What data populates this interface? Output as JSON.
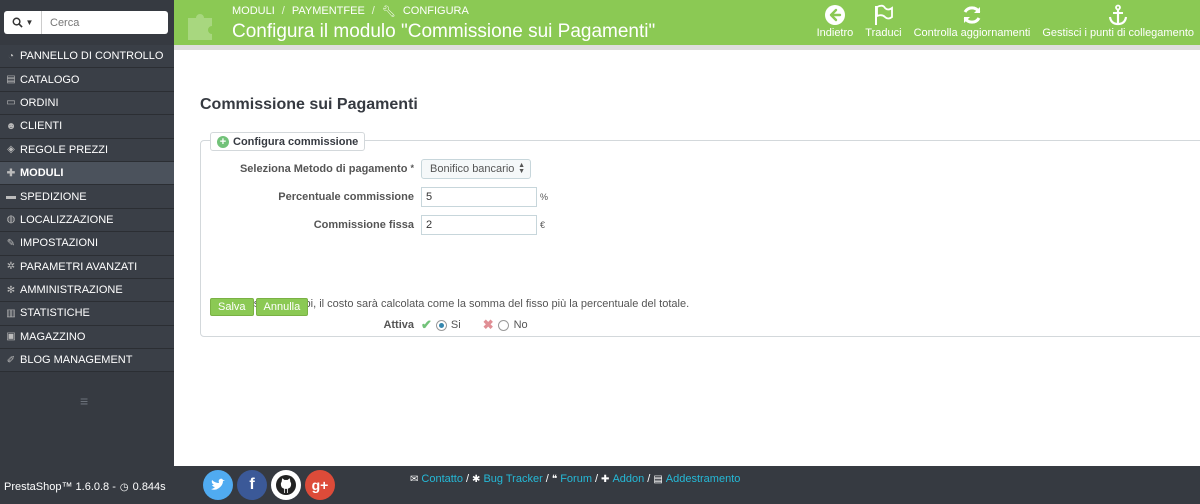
{
  "sidebar": {
    "search": {
      "placeholder": "Cerca"
    },
    "items": [
      {
        "label": "PANNELLO DI CONTROLLO",
        "icon": "dashboard-icon",
        "glyph": "◔"
      },
      {
        "label": "CATALOGO",
        "icon": "book-icon",
        "glyph": "▤"
      },
      {
        "label": "ORDINI",
        "icon": "credit-card-icon",
        "glyph": "▭"
      },
      {
        "label": "CLIENTI",
        "icon": "users-icon",
        "glyph": "☻"
      },
      {
        "label": "REGOLE PREZZI",
        "icon": "tag-icon",
        "glyph": "◈"
      },
      {
        "label": "MODULI",
        "icon": "puzzle-icon",
        "glyph": "✚"
      },
      {
        "label": "SPEDIZIONE",
        "icon": "truck-icon",
        "glyph": "▬"
      },
      {
        "label": "LOCALIZZAZIONE",
        "icon": "globe-icon",
        "glyph": "◍"
      },
      {
        "label": "IMPOSTAZIONI",
        "icon": "wrench-icon",
        "glyph": "✎"
      },
      {
        "label": "PARAMETRI AVANZATI",
        "icon": "cogs-icon",
        "glyph": "✲"
      },
      {
        "label": "AMMINISTRAZIONE",
        "icon": "cog-icon",
        "glyph": "✻"
      },
      {
        "label": "STATISTICHE",
        "icon": "bar-chart-icon",
        "glyph": "▥"
      },
      {
        "label": "MAGAZZINO",
        "icon": "archive-icon",
        "glyph": "▣"
      },
      {
        "label": "BLOG MANAGEMENT",
        "icon": "pencil-icon",
        "glyph": "✐"
      }
    ],
    "active_index": 5
  },
  "header": {
    "breadcrumb": [
      "MODULI",
      "PAYMENTFEE",
      "CONFIGURA"
    ],
    "title": "Configura il modulo \"Commissione sui Pagamenti\"",
    "toolbar": [
      {
        "label": "Indietro",
        "icon": "arrow-circle-left-icon"
      },
      {
        "label": "Traduci",
        "icon": "flag-icon"
      },
      {
        "label": "Controlla aggiornamenti",
        "icon": "refresh-icon"
      },
      {
        "label": "Gestisci i punti di collegamento",
        "icon": "anchor-icon"
      }
    ]
  },
  "content": {
    "section_title": "Commissione sui Pagamenti",
    "panel_title": "Configura commissione",
    "payment_method": {
      "label": "Seleziona Metodo di pagamento",
      "required_mark": "*",
      "value": "Bonifico bancario"
    },
    "percent_fee": {
      "label": "Percentuale commissione",
      "value": "5",
      "unit": "%"
    },
    "fixed_fee": {
      "label": "Commissione fissa",
      "value": "2",
      "unit": "€"
    },
    "help_text": "Se inserisci entrambi, il costo sarà calcolata come la somma del fisso più la percentuale del totale.",
    "active": {
      "label": "Attiva",
      "yes": "Si",
      "no": "No",
      "selected": "yes"
    },
    "buttons": {
      "save": "Salva",
      "cancel": "Annulla"
    }
  },
  "footer": {
    "version": "PrestaShop™ 1.6.0.8 -",
    "load_time": "0.844s",
    "links": [
      "Contatto",
      "Bug Tracker",
      "Forum",
      "Addon",
      "Addestramento"
    ]
  },
  "colors": {
    "accent_green": "#8bc954",
    "sidebar_bg": "#363a41",
    "link_blue": "#25b9d7"
  }
}
